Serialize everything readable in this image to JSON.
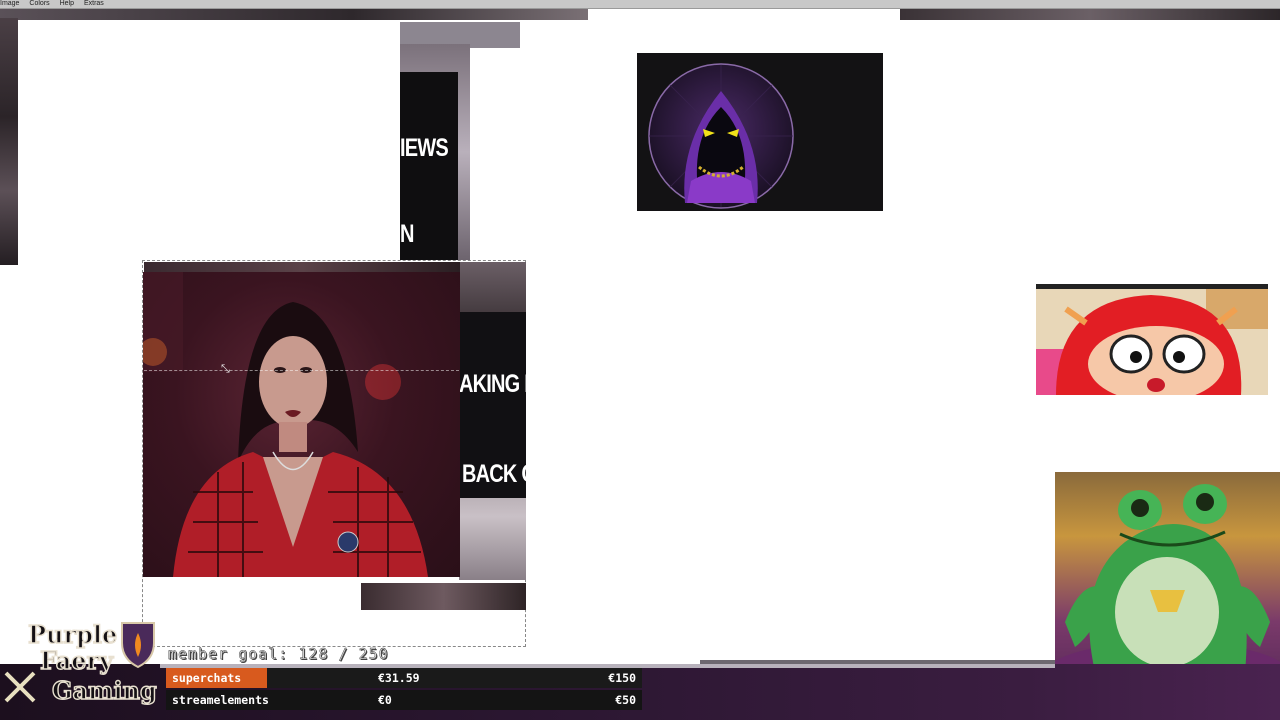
{
  "menu": {
    "items": [
      "Image",
      "Colors",
      "Help",
      "Extras"
    ]
  },
  "news_panel": {
    "line1": "IEWS",
    "line2": "N"
  },
  "cam_news": {
    "line1": "AKING N",
    "line2": "BACK O"
  },
  "brand": {
    "line1": "Purple",
    "line2": "Faery",
    "line3": "Gaming"
  },
  "member_goal": {
    "text": "member goal: 128 / 250",
    "current": 128,
    "target": 250
  },
  "donations": [
    {
      "label": "superchats",
      "amount": "€31.59",
      "goal": "€150"
    },
    {
      "label": "streamelements",
      "amount": "€0",
      "goal": "€50"
    }
  ],
  "colors": {
    "accent_orange": "#d85a1e",
    "hood_purple": "#5b2a8c",
    "eye_yellow": "#f2e21a",
    "frog_green": "#3aa24a"
  },
  "icons": [
    "hooded-figure-icon",
    "resize-cursor-icon",
    "shield-crest-icon",
    "frog-figure",
    "cartoon-face"
  ]
}
